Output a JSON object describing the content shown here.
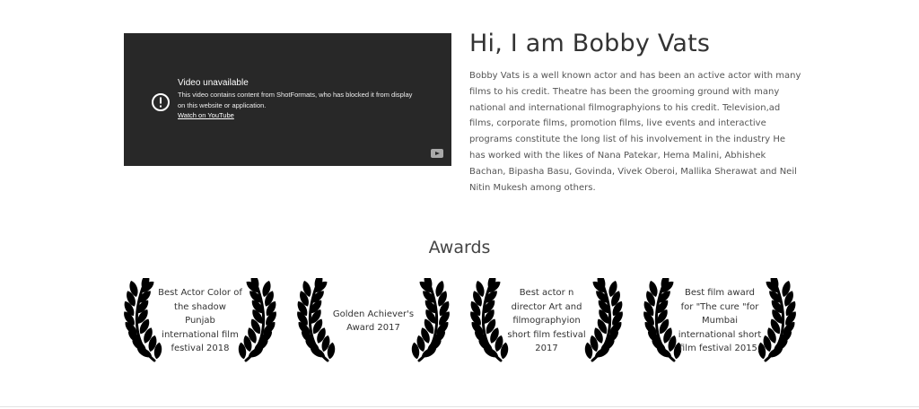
{
  "video": {
    "title": "Video unavailable",
    "message": "This video contains content from ShotFormats, who has blocked it from display on this website or application.",
    "link": "Watch on YouTube",
    "icons": [
      "info-icon",
      "youtube-icon"
    ]
  },
  "hero": {
    "title": "Hi, I am Bobby Vats",
    "bio": "Bobby Vats is a well known actor and has been an active actor with many films to his credit. Theatre has been the grooming ground with many national and international filmographyions to his credit. Television,ad films, corporate films, promotion films, live events and interactive programs constitute the long list of his involvement in the industry He has worked with the likes of Nana Patekar, Hema Malini, Abhishek Bachan, Bipasha Basu, Govinda, Vivek Oberoi, Mallika Sherawat and Neil Nitin Mukesh among others."
  },
  "awards": {
    "title": "Awards",
    "items": [
      {
        "text": "Best Actor Color of the shadow Punjab international film festival 2018"
      },
      {
        "text": "Golden Achiever's Award 2017"
      },
      {
        "text": "Best actor n director Art and filmographyion short film festival 2017"
      },
      {
        "text": "Best film award for \"The cure \"for Mumbai international short film festival 2015."
      }
    ],
    "icon": "laurel-wreath-icon"
  },
  "colors": {
    "video_bg": "#282828",
    "text": "#333333",
    "laurel": "#000000"
  }
}
